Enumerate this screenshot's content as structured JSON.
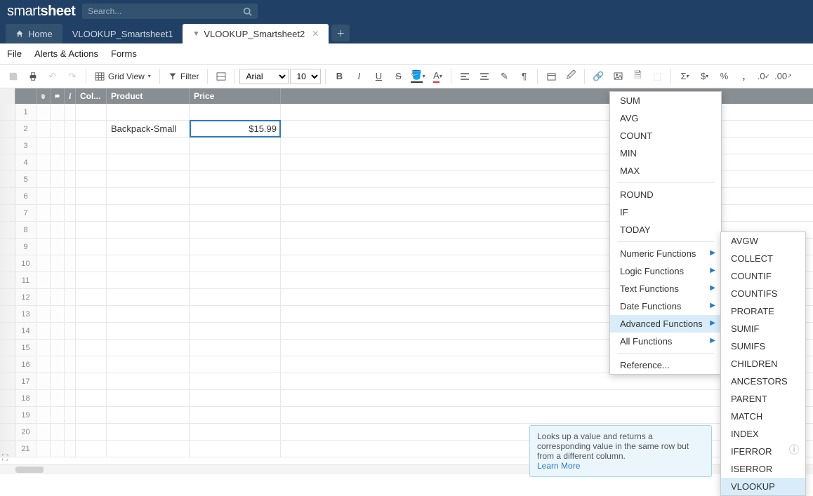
{
  "header": {
    "logo_prefix": "smart",
    "logo_suffix": "sheet",
    "search_placeholder": "Search..."
  },
  "tabs": {
    "home": "Home",
    "sheet1": "VLOOKUP_Smartsheet1",
    "sheet2": "VLOOKUP_Smartsheet2"
  },
  "menubar": {
    "file": "File",
    "alerts": "Alerts & Actions",
    "forms": "Forms"
  },
  "toolbar": {
    "grid_view": "Grid View",
    "filter": "Filter",
    "font_name": "Arial",
    "font_size": "10"
  },
  "columns": {
    "col": "Col...",
    "product": "Product",
    "price": "Price"
  },
  "row_data": {
    "r2_product": "Backpack-Small",
    "r2_price": "$15.99"
  },
  "func_menu": {
    "sum": "SUM",
    "avg": "AVG",
    "count": "COUNT",
    "min": "MIN",
    "max": "MAX",
    "round": "ROUND",
    "if": "IF",
    "today": "TODAY",
    "numeric": "Numeric Functions",
    "logic": "Logic Functions",
    "text": "Text Functions",
    "date": "Date Functions",
    "advanced": "Advanced Functions",
    "all": "All Functions",
    "reference": "Reference..."
  },
  "adv_menu": {
    "avgw": "AVGW",
    "collect": "COLLECT",
    "countif": "COUNTIF",
    "countifs": "COUNTIFS",
    "prorate": "PRORATE",
    "sumif": "SUMIF",
    "sumifs": "SUMIFS",
    "children": "CHILDREN",
    "ancestors": "ANCESTORS",
    "parent": "PARENT",
    "match": "MATCH",
    "index": "INDEX",
    "iferror": "IFERROR",
    "iserror": "ISERROR",
    "vlookup": "VLOOKUP"
  },
  "tooltip": {
    "text": "Looks up a value and returns a corresponding value in the same row but from a different column.",
    "link": "Learn More"
  },
  "row_numbers": [
    "1",
    "2",
    "3",
    "4",
    "5",
    "6",
    "7",
    "8",
    "9",
    "10",
    "11",
    "12",
    "13",
    "14",
    "15",
    "16",
    "17",
    "18",
    "19",
    "20",
    "21"
  ]
}
